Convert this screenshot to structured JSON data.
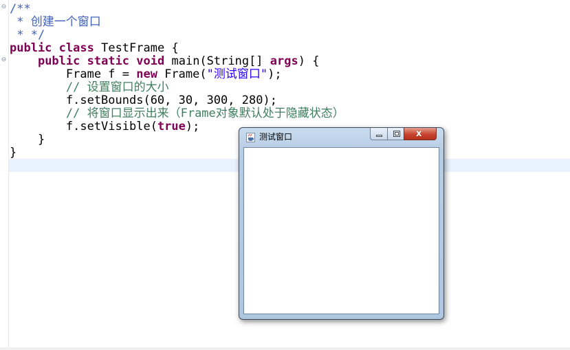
{
  "editor": {
    "lines": [
      {
        "parts": [
          {
            "t": "/**",
            "c": "jd"
          }
        ]
      },
      {
        "parts": [
          {
            "t": " * 创建一个窗口",
            "c": "jd"
          }
        ]
      },
      {
        "parts": [
          {
            "t": " * */",
            "c": "jd"
          }
        ]
      },
      {
        "parts": [
          {
            "t": "public",
            "c": "kw"
          },
          {
            "t": " "
          },
          {
            "t": "class",
            "c": "kw"
          },
          {
            "t": " TestFrame {"
          }
        ]
      },
      {
        "parts": [
          {
            "t": "    "
          },
          {
            "t": "public",
            "c": "kw"
          },
          {
            "t": " "
          },
          {
            "t": "static",
            "c": "kw"
          },
          {
            "t": " "
          },
          {
            "t": "void",
            "c": "kw"
          },
          {
            "t": " main(String[] "
          },
          {
            "t": "args",
            "c": "kw"
          },
          {
            "t": ") {"
          }
        ]
      },
      {
        "parts": [
          {
            "t": "        Frame f = "
          },
          {
            "t": "new",
            "c": "kw"
          },
          {
            "t": " Frame("
          },
          {
            "t": "\"测试窗口\"",
            "c": "st"
          },
          {
            "t": ");"
          }
        ]
      },
      {
        "parts": [
          {
            "t": "        "
          },
          {
            "t": "// 设置窗口的大小",
            "c": "cm"
          }
        ]
      },
      {
        "parts": [
          {
            "t": "        f.setBounds(60, 30, 300, 280);"
          }
        ]
      },
      {
        "parts": [
          {
            "t": "        "
          },
          {
            "t": "// 将窗口显示出来（Frame对象默认处于隐藏状态）",
            "c": "cm"
          }
        ]
      },
      {
        "parts": [
          {
            "t": "        f.setVisible("
          },
          {
            "t": "true",
            "c": "kw"
          },
          {
            "t": ");"
          }
        ]
      },
      {
        "parts": [
          {
            "t": "    }"
          }
        ]
      },
      {
        "parts": [
          {
            "t": "}"
          }
        ]
      }
    ]
  },
  "frame_window": {
    "title": "测试窗口",
    "close_label": "x",
    "minimize_icon": "minimize-icon",
    "maximize_icon": "maximize-icon",
    "app_icon": "java-cup-icon"
  },
  "colors": {
    "keyword": "#7f0055",
    "javadoc": "#3f5fbf",
    "comment": "#3f7f5f",
    "string": "#2a00ff",
    "current_line": "#e8f2fe"
  }
}
